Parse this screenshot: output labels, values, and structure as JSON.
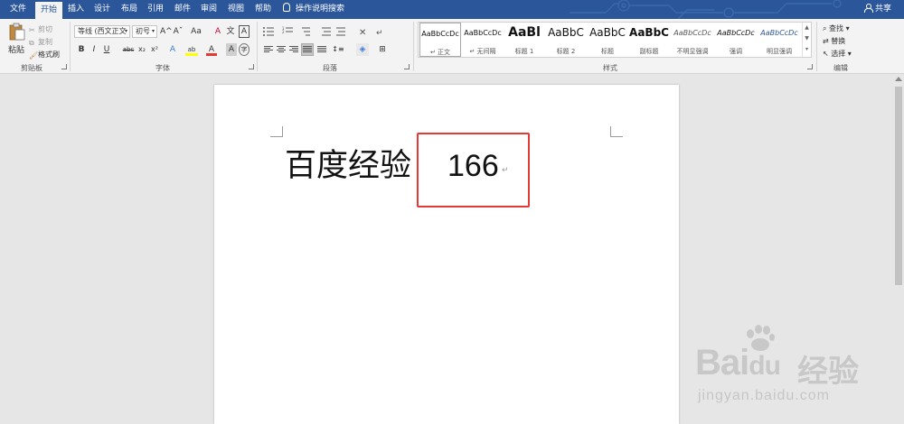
{
  "tabs": [
    "文件",
    "开始",
    "插入",
    "设计",
    "布局",
    "引用",
    "邮件",
    "审阅",
    "视图",
    "帮助"
  ],
  "active_tab": "开始",
  "tell_me": "操作说明搜索",
  "share": "共享",
  "clipboard": {
    "paste": "粘贴",
    "cut": "剪切",
    "copy": "复制",
    "format_painter": "格式刷",
    "label": "剪贴板"
  },
  "font": {
    "font_name": "等线 (西文正文",
    "font_size": "初号",
    "grow": "A^",
    "shrink": "Aˇ",
    "case": "Aa",
    "clear": "A",
    "phonetic": "文",
    "border": "A",
    "bold": "B",
    "italic": "I",
    "underline": "U",
    "strike": "abc",
    "sub": "x₂",
    "sup": "x²",
    "effects": "A",
    "highlight": "ab",
    "color": "A",
    "shade": "A",
    "enclose": "字",
    "label": "字体"
  },
  "paragraph": {
    "label": "段落"
  },
  "styles": {
    "label": "样式",
    "items": [
      {
        "sample": "AaBbCcDc",
        "name": "↵ 正文"
      },
      {
        "sample": "AaBbCcDc",
        "name": "↵ 无间隔"
      },
      {
        "sample": "AaBl",
        "name": "标题 1"
      },
      {
        "sample": "AaBbC",
        "name": "标题 2"
      },
      {
        "sample": "AaBbC",
        "name": "标题"
      },
      {
        "sample": "AaBbC",
        "name": "副标题"
      },
      {
        "sample": "AaBbCcDc",
        "name": "不明显强调"
      },
      {
        "sample": "AaBbCcDc",
        "name": "强调"
      },
      {
        "sample": "AaBbCcDc",
        "name": "明显强调"
      }
    ]
  },
  "editing": {
    "find": "查找",
    "replace": "替换",
    "select": "选择",
    "label": "编辑"
  },
  "document": {
    "text": "百度经验",
    "number": "166",
    "para_mark": "↵"
  },
  "watermark": {
    "logo": "Bai",
    "logo_du": "du",
    "logo_cn": "经验",
    "url": "jingyan.baidu.com"
  },
  "colors": {
    "title_bar": "#2b579a",
    "ribbon": "#f3f3f3",
    "highlight_box": "#e53935",
    "font_color_bar": "#e53935",
    "highlight_bar": "#ffff00"
  }
}
